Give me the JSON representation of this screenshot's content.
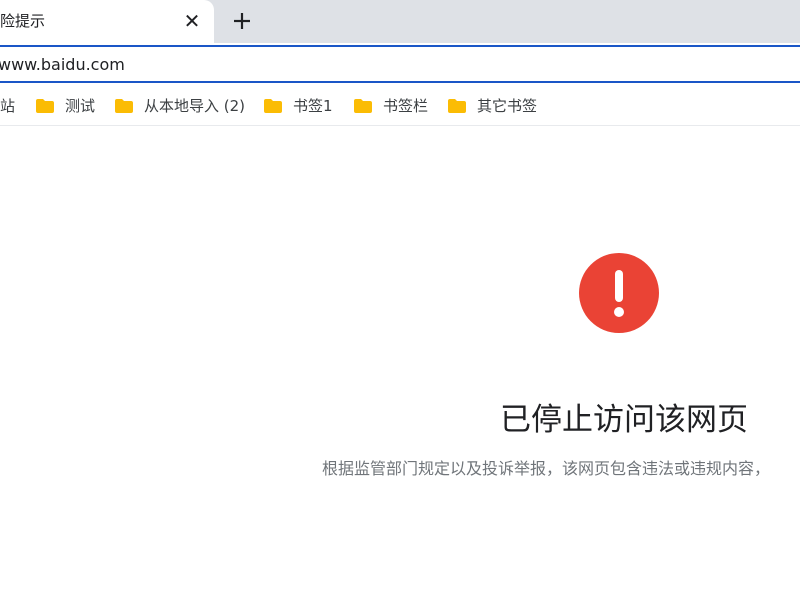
{
  "tab": {
    "title": "险提示",
    "close_glyph": "✕"
  },
  "omnibox": {
    "url": "www.baidu.com"
  },
  "bookmarks": [
    {
      "label": "站",
      "icon": "none"
    },
    {
      "label": "测试",
      "icon": "folder-icon"
    },
    {
      "label": "从本地导入 (2)",
      "icon": "folder-icon"
    },
    {
      "label": "书签1",
      "icon": "folder-icon"
    },
    {
      "label": "书签栏",
      "icon": "folder-icon"
    },
    {
      "label": "其它书签",
      "icon": "folder-icon"
    }
  ],
  "block_page": {
    "icon": "exclamation-alert-icon",
    "icon_color": "#ea4335",
    "title": "已停止访问该网页",
    "description": "根据监管部门规定以及投诉举报，该网页包含违法或违规内容，"
  },
  "colors": {
    "tab_strip": "#dee1e6",
    "omnibox_border": "#1a56c7",
    "folder": "#fbbc04"
  }
}
